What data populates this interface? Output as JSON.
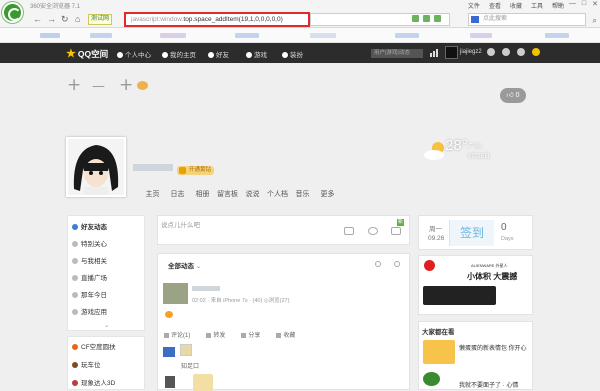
{
  "browser": {
    "title": "360安全浏览器 7.1",
    "menu": [
      "文件",
      "查看",
      "收藏",
      "工具",
      "帮助"
    ],
    "window_buttons": [
      "▭",
      "—",
      "□",
      "✕"
    ],
    "tab_label": "测试网",
    "url_prefix": "javascript:window.",
    "url": "top.space_addItem(19,1,0,0,0,0,0)",
    "search_placeholder": "点此搜索"
  },
  "qzone_nav": {
    "logo": "QQ空间",
    "items": [
      "个人中心",
      "我的主页",
      "好友",
      "游戏",
      "装扮"
    ],
    "search_placeholder": "用户|游戏|动态",
    "username": "jiajiegz2"
  },
  "topbar": {
    "plus": "+",
    "minus": "—",
    "like_count": "0"
  },
  "profile": {
    "vip_label": "开通黄钻",
    "tabs": [
      "主页",
      "日志",
      "相册",
      "留言板",
      "说说",
      "个人档",
      "音乐",
      "更多"
    ]
  },
  "weather": {
    "temp": "28°",
    "city": "广州",
    "date": "9月28日"
  },
  "left_menu": {
    "items": [
      "好友动态",
      "特别关心",
      "与我相关",
      "直播广场",
      "那年今日",
      "游戏应用"
    ],
    "more": "⌄",
    "bottom_items": [
      "CF空度圆扶",
      "玩车位",
      "现象达人3D"
    ]
  },
  "composer": {
    "placeholder": "说点儿什么吧",
    "new_badge": "新"
  },
  "feed": {
    "filter_label": "全部动态",
    "post_meta": "02:02 · 来自 iPhone 7s · (40)  ◎浏览(27)",
    "actions": [
      "评论(1)",
      "转发",
      "分享",
      "收藏"
    ],
    "thumb_text": "知足口"
  },
  "signin": {
    "weekday": "周一",
    "date": "09.26",
    "button": "签到",
    "days": "0",
    "days_label": "Days"
  },
  "ad": {
    "brand": "ALIENWARE 外星人",
    "slogan": "小体积 大震撼"
  },
  "friends_panel": {
    "title": "大家都在看",
    "item1": "懒蛋蛋的新表情包  你开心",
    "item2": "我就不要面子了 · 心情"
  },
  "colors": {
    "url_border": "#e3272d",
    "qnav_bg": "#2c2c2c",
    "brand_green": "#3a9a2f",
    "vip_gold": "#f4d37c"
  }
}
